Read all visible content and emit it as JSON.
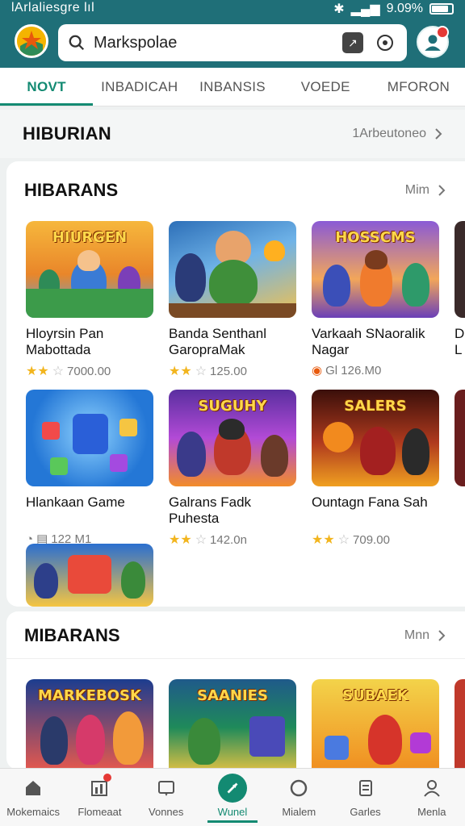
{
  "status": {
    "left_text": "lArlaliesgre lıl",
    "right_text": "9.09%"
  },
  "search": {
    "value": "Markspolae"
  },
  "tabs": [
    {
      "label": "NOVT",
      "active": true
    },
    {
      "label": "INBADICAH",
      "active": false
    },
    {
      "label": "INBANSIS",
      "active": false
    },
    {
      "label": "VOEDE",
      "active": false
    },
    {
      "label": "MFORON",
      "active": false
    }
  ],
  "section1": {
    "title": "HIBURIAN",
    "more": "1Arbeutoneo"
  },
  "card1": {
    "title": "HIBARANS",
    "more": "Mim",
    "games": [
      {
        "banner": "HIURGEN",
        "name": "Hloyrsin Pan Mabottada",
        "rating": 2,
        "meta": "7000.00",
        "theme": "#f4a324",
        "theme2": "#4fa0e8"
      },
      {
        "banner": "",
        "name": "Banda Senthanl GaropraMak",
        "rating": 2,
        "meta": "125.00",
        "theme": "#2d6fb8",
        "theme2": "#f2c14e"
      },
      {
        "banner": "HOSSCMS",
        "name": "Varkaah SNaoralik Nagar",
        "rating": 0,
        "meta": "Gl 126.M0",
        "theme": "#6a3fb8",
        "theme2": "#f07b2d"
      },
      {
        "banner": "",
        "name": "Hlankaan Game",
        "rating": 0,
        "meta": "122 M1",
        "theme": "#2477d6",
        "theme2": "#43c0f5"
      },
      {
        "banner": "SUGUHY",
        "name": "Galrans Fadk Puhesta",
        "rating": 2,
        "meta": "142.0n",
        "theme": "#5a2fa0",
        "theme2": "#f28c2a"
      },
      {
        "banner": "SALERS",
        "name": "Ountagn Fana Sah",
        "rating": 2,
        "meta": "709.00",
        "theme": "#b03a1e",
        "theme2": "#f0a020"
      },
      {
        "banner": "",
        "name": "",
        "rating": 0,
        "meta": "",
        "theme": "#2b6fd0",
        "theme2": "#f5c542"
      }
    ],
    "partial_names": [
      "D",
      "L"
    ]
  },
  "card2": {
    "title": "MIBARANS",
    "more": "Mnn",
    "games": [
      {
        "banner": "MARKEBOSK",
        "theme": "#1c3d8f",
        "theme2": "#f15a4a"
      },
      {
        "banner": "SAANIES",
        "theme": "#1f8a5a",
        "theme2": "#f3c641"
      },
      {
        "banner": "SUBAEK",
        "theme": "#f08a1e",
        "theme2": "#f3d34a"
      }
    ]
  },
  "bottomnav": [
    {
      "label": "Mokemaics",
      "icon": "home-icon"
    },
    {
      "label": "Flomeaat",
      "icon": "chart-icon"
    },
    {
      "label": "Vonnes",
      "icon": "chat-icon"
    },
    {
      "label": "Wunel",
      "icon": "compass-icon",
      "active": true
    },
    {
      "label": "Mialem",
      "icon": "circle-icon"
    },
    {
      "label": "Garles",
      "icon": "doc-icon"
    },
    {
      "label": "Menla",
      "icon": "person-icon"
    }
  ],
  "colors": {
    "brand": "#1f6f78",
    "accent": "#138a72",
    "star": "#f2b51e"
  }
}
